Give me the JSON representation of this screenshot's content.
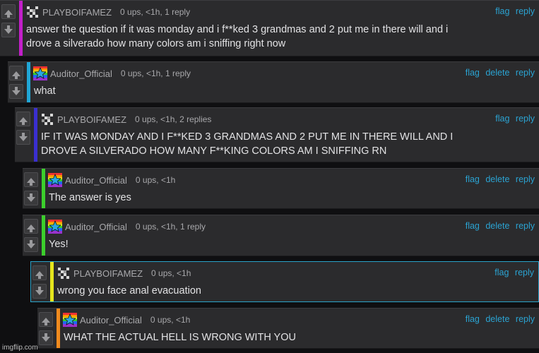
{
  "comments": [
    {
      "user": "PLAYBOIFAMEZ",
      "meta": "0 ups, <1h, 1 reply",
      "links": [
        "flag",
        "reply"
      ],
      "lines": [
        "answer the question if it was monday and i f**ked 3 grandmas and 2 put me in there will and i",
        "drove a silverado how many colors am i sniffing right now"
      ]
    },
    {
      "user": "Auditor_Official",
      "meta": "0 ups, <1h, 1 reply",
      "links": [
        "flag",
        "delete",
        "reply"
      ],
      "lines": [
        "what"
      ]
    },
    {
      "user": "PLAYBOIFAMEZ",
      "meta": "0 ups, <1h, 2 replies",
      "links": [
        "flag",
        "reply"
      ],
      "lines": [
        "IF IT WAS MONDAY AND I F**KED 3 GRANDMAS AND 2 PUT ME IN THERE WILL AND I",
        "DROVE A SILVERADO HOW MANY F**KING COLORS AM I SNIFFING RN"
      ]
    },
    {
      "user": "Auditor_Official",
      "meta": "0 ups, <1h",
      "links": [
        "flag",
        "delete",
        "reply"
      ],
      "lines": [
        "The answer is yes"
      ]
    },
    {
      "user": "Auditor_Official",
      "meta": "0 ups, <1h, 1 reply",
      "links": [
        "flag",
        "delete",
        "reply"
      ],
      "lines": [
        "Yes!"
      ]
    },
    {
      "user": "PLAYBOIFAMEZ",
      "meta": "0 ups, <1h",
      "links": [
        "flag",
        "reply"
      ],
      "lines": [
        "wrong you face anal evacuation"
      ]
    },
    {
      "user": "Auditor_Official",
      "meta": "0 ups, <1h",
      "links": [
        "flag",
        "delete",
        "reply"
      ],
      "lines": [
        "WHAT THE ACTUAL HELL IS WRONG WITH YOU"
      ]
    }
  ],
  "colors": {
    "link": "#2ba3d2",
    "stripes": [
      "#c21fc9",
      "#20a6d6",
      "#3a2fd0",
      "#3ccf2c",
      "#3ccf2c",
      "#e5e51d",
      "#f08a1e"
    ]
  },
  "icons": {
    "vote_up": "up-arrow-icon",
    "vote_down": "down-arrow-icon",
    "avatar_playboi": "pixel-glitch-avatar-icon",
    "avatar_auditor": "rainbow-star-avatar-icon"
  },
  "watermark": "imgflip.com"
}
